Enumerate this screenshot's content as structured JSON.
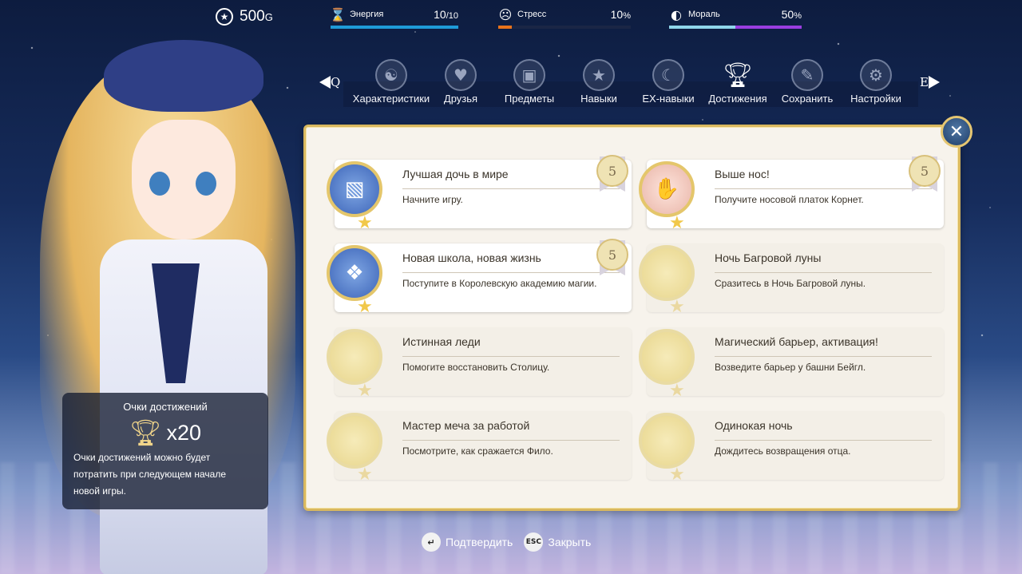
{
  "hud": {
    "gold": "500",
    "gold_unit": "G",
    "energy": {
      "label": "Энергия",
      "value": "10",
      "max": "/10",
      "fraction": 1.0,
      "color": "#1e9bd8"
    },
    "stress": {
      "label": "Стресс",
      "value": "10",
      "unit": "%",
      "fraction": 0.1,
      "color": "#e8731b"
    },
    "morale": {
      "label": "Мораль",
      "value": "50",
      "unit": "%",
      "fraction": 0.5,
      "color": "#9a3ee0"
    }
  },
  "nav": {
    "prev_key": "Q",
    "next_key": "E",
    "items": [
      {
        "label": "Характеристики",
        "icon": "stats-icon"
      },
      {
        "label": "Друзья",
        "icon": "friends-icon"
      },
      {
        "label": "Предметы",
        "icon": "items-icon"
      },
      {
        "label": "Навыки",
        "icon": "skills-icon"
      },
      {
        "label": "EX-навыки",
        "icon": "ex-skills-icon"
      },
      {
        "label": "Достижения",
        "icon": "trophy-icon"
      },
      {
        "label": "Сохранить",
        "icon": "save-icon"
      },
      {
        "label": "Настройки",
        "icon": "settings-icon"
      }
    ],
    "active": "Достижения"
  },
  "points": {
    "title": "Очки достижений",
    "multiplier": "x20",
    "desc_lines": [
      "Очки достижений можно будет",
      "потратить при следующем начале",
      "новой игры."
    ]
  },
  "achievements": [
    {
      "title": "Лучшая дочь в мире",
      "desc": "Начните игру.",
      "points": "5",
      "unlocked": true
    },
    {
      "title": "Выше нос!",
      "desc": "Получите носовой платок Корнет.",
      "points": "5",
      "unlocked": true
    },
    {
      "title": "Новая школа, новая жизнь",
      "desc": "Поступите в Королевскую академию магии.",
      "points": "5",
      "unlocked": true
    },
    {
      "title": "Ночь Багровой луны",
      "desc": "Сразитесь в Ночь Багровой луны.",
      "unlocked": false
    },
    {
      "title": "Истинная леди",
      "desc": "Помогите восстановить Столицу.",
      "unlocked": false
    },
    {
      "title": "Магический барьер, активация!",
      "desc": "Возведите барьер у башни Бейгл.",
      "unlocked": false
    },
    {
      "title": "Мастер меча за работой",
      "desc": "Посмотрите, как сражается Фило.",
      "unlocked": false
    },
    {
      "title": "Одинокая ночь",
      "desc": "Дождитесь возвращения отца.",
      "unlocked": false
    }
  ],
  "hints": {
    "confirm_key": "↵",
    "confirm_label": "Подтвердить",
    "close_key": "ESC",
    "close_label": "Закрыть"
  }
}
